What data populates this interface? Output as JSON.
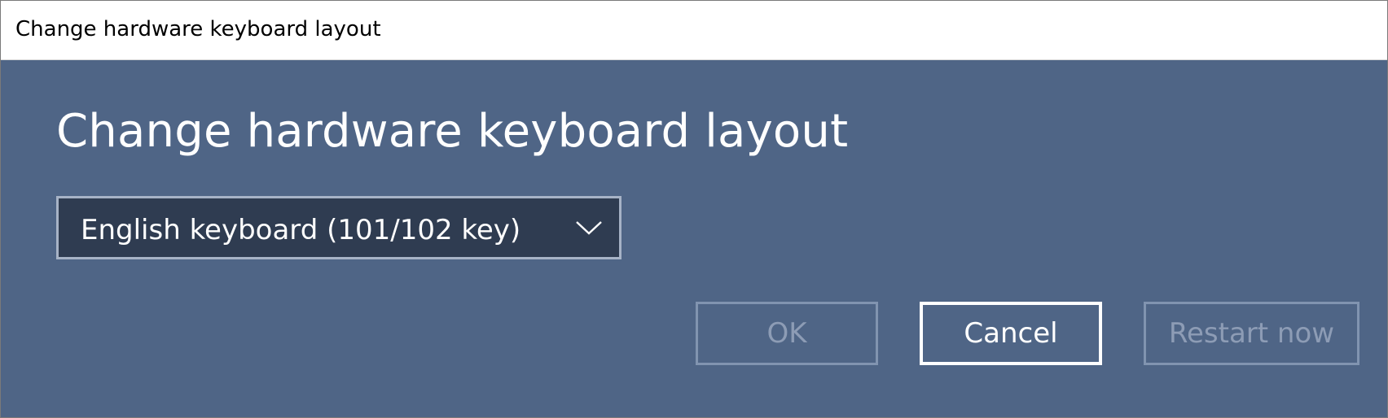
{
  "window": {
    "title": "Change hardware keyboard layout"
  },
  "main": {
    "heading": "Change hardware keyboard layout",
    "layout_select": {
      "selected": "English keyboard (101/102 key)",
      "icon": "chevron-down-icon"
    }
  },
  "buttons": {
    "ok": {
      "label": "OK",
      "enabled": false
    },
    "cancel": {
      "label": "Cancel",
      "enabled": true
    },
    "restart": {
      "label": "Restart now",
      "enabled": false
    }
  },
  "colors": {
    "dialog_background": "#4f6586",
    "dropdown_background": "#2f3c51",
    "dropdown_border": "#a7b3c6",
    "disabled_text": "#8d9cb5",
    "disabled_border": "#8194b0",
    "active_border": "#ffffff"
  }
}
